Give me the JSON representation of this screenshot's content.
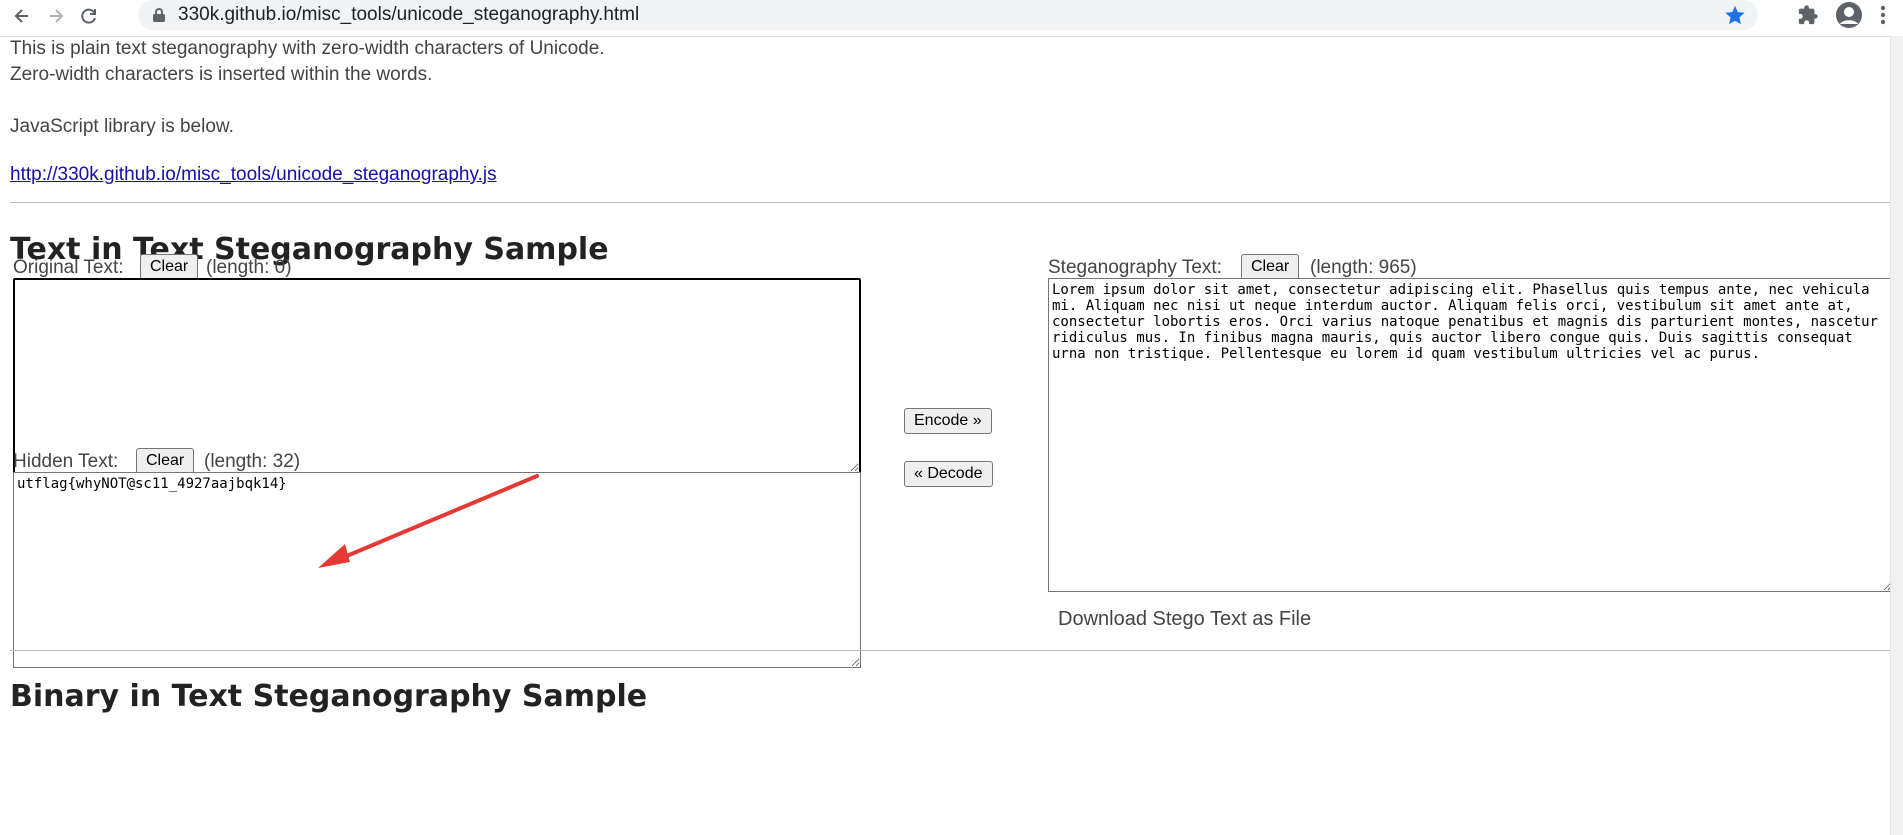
{
  "browser": {
    "url": "330k.github.io/misc_tools/unicode_steganography.html"
  },
  "intro": {
    "line1": "This is plain text steganography with zero-width characters of Unicode.",
    "line2": "Zero-width characters is inserted within the words.",
    "line3": "JavaScript library is below.",
    "library_link": "http://330k.github.io/misc_tools/unicode_steganography.js"
  },
  "section": {
    "title": "Text in Text Steganography Sample"
  },
  "original": {
    "label": "Original Text:",
    "clear_label": "Clear",
    "length": "(length: 0)",
    "value": ""
  },
  "hidden": {
    "label": "Hidden Text:",
    "clear_label": "Clear",
    "length": "(length: 32)",
    "value": "utflag{whyNOT@sc11_4927aajbqk14}"
  },
  "actions": {
    "encode_label": "Encode »",
    "decode_label": "« Decode"
  },
  "stego": {
    "label": "Steganography Text:",
    "clear_label": "Clear",
    "length": "(length: 965)",
    "value": "Lorem ipsum dolor sit amet, consectetur adipiscing elit. Phasellus quis tempus ante, nec vehicula mi. Aliquam nec nisi ut neque interdum auctor. Aliquam felis orci, vestibulum sit amet ante at, consectetur lobortis eros. Orci varius natoque penatibus et magnis dis parturient montes, nascetur ridiculus mus. In finibus magna mauris, quis auctor libero congue quis. Duis sagittis consequat urna non tristique. Pellentesque eu lorem id quam vestibulum ultricies vel ac purus.",
    "download_label": "Download Stego Text as File"
  },
  "next_section": {
    "title": "Binary in Text Steganography Sample"
  },
  "colors": {
    "annotation_arrow": "#e53935",
    "link": "#1a0dab",
    "bookmark_star": "#1a73e8"
  }
}
